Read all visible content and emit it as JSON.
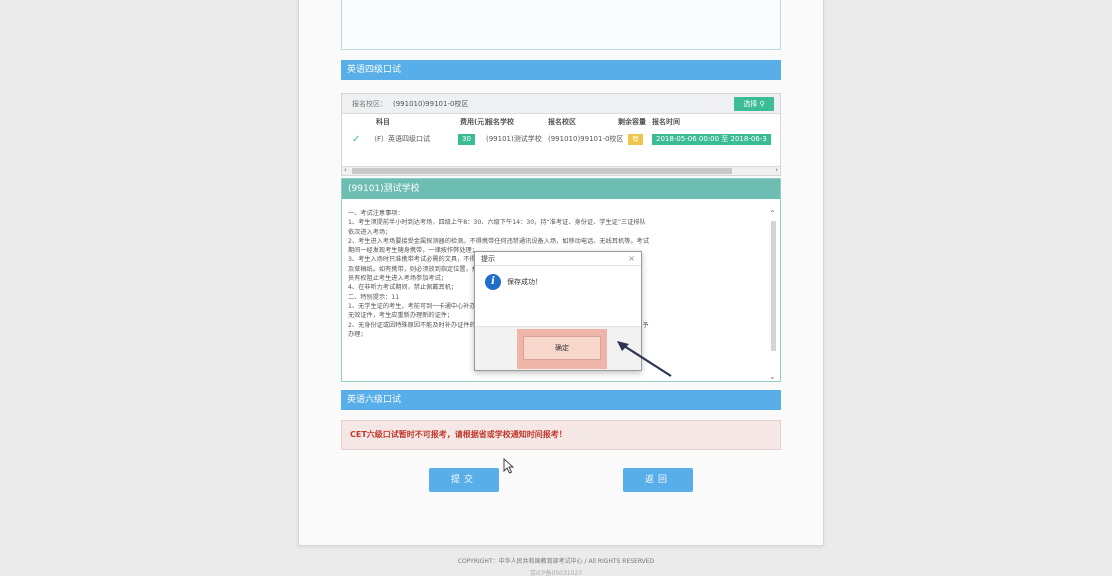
{
  "section_cet4_title": "英语四级口试",
  "campus_label": "报名校区：",
  "campus_value": "(991010)99101-0校区",
  "choose_button": "选择",
  "table": {
    "headers": [
      "科目",
      "费用(元)",
      "报名学校",
      "报名校区",
      "剩余容量",
      "报名时间"
    ],
    "row": {
      "subject": "（F）英语四级口试",
      "fee": "30",
      "school": "(99101)测试学校",
      "campus": "(991010)99101-0校区",
      "remaining": "有",
      "time": "2018-05-06 00:00 至 2018-06-3"
    }
  },
  "school_title": "(99101)测试学校",
  "notice_lines": [
    "一、考试注意事项：",
    "1、考生须提前半小时到达考场，四级上午8：30、六级下午14：30，持“准考证、身份证、学生证”三证排队",
    "依次进入考场；",
    "2、考生进入考场要接受金属探测器的检测。不得携带任何违禁通讯设备入场，如移动电话、无线耳机等。考试",
    "期间一经发现考生随身携带，一律按作弊处理；",
    "3、考生入场时只准携带考试必需的文具，不得携带任何书籍、笔记、资料以",
    "及草稿纸。如有携带，则必须放到指定位置，并配合检查工作。如拒不配合，监考人",
    "员有权阻止考生进入考场参加考试；",
    "4、在非听力考试期间，禁止佩戴耳机；",
    "二、特别提示：11",
    "1、无学生证的考生，考前可到一卡通中心补办，若照片如已模糊不清，将被视为",
    "无效证件，考生应重新办理新的证件；",
    "2、无身份证或因特殊原因不能及时补办证件的考生，可持准考证到所在学院开具CET专用证明，考试当天不予",
    "办理；"
  ],
  "section_cet6_title": "英语六级口试",
  "cet6_alert": "CET六级口试暂时不可报考，请根据省或学校通知时间报考！",
  "submit_button": "提交",
  "back_button": "返回",
  "footer_copyright": "COPYRIGHT：中华人民共和国教育部考试中心 / All RIGHTS RESERVED",
  "footer_icp": "京ICP备05031027",
  "dialog": {
    "title": "提示",
    "close": "×",
    "message": "保存成功！",
    "ok": "确定"
  }
}
